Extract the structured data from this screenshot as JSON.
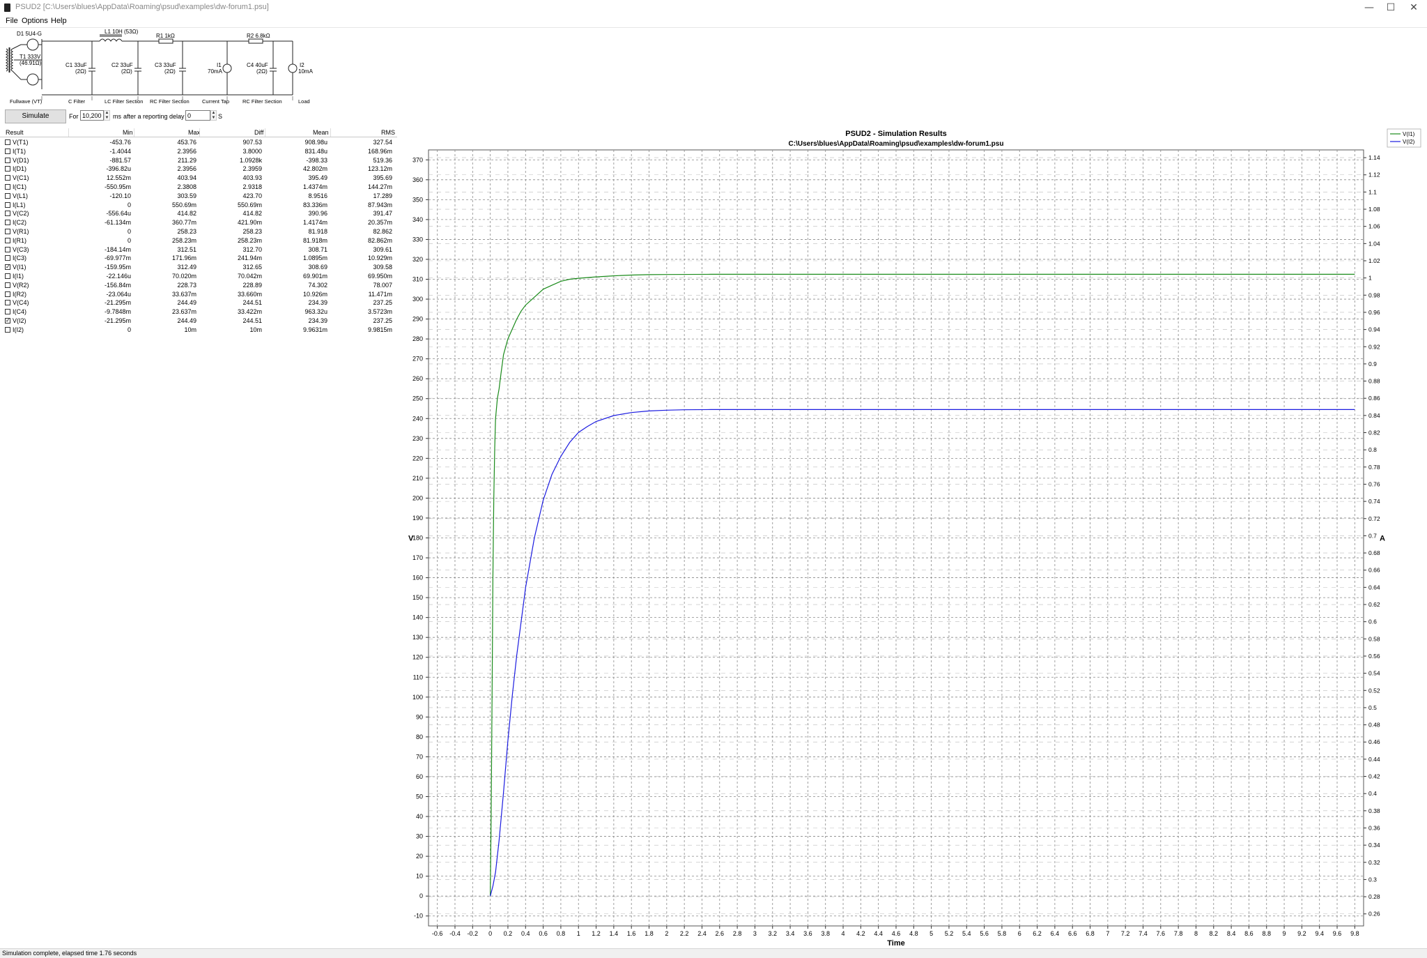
{
  "window": {
    "title": "PSUD2  [C:\\Users\\blues\\AppData\\Roaming\\psud\\examples\\dw-forum1.psu]",
    "minimize": "—",
    "maximize": "☐",
    "close": "✕"
  },
  "menu": {
    "items": [
      "File",
      "Options",
      "Help"
    ]
  },
  "schematic": {
    "labels": {
      "d1": "D1 5U4-G",
      "t1_a": "T1 333V",
      "t1_b": "(46.91Ω)",
      "l1": "L1 10H (53Ω)",
      "r1": "R1 1kΩ",
      "r2": "R2 6.8kΩ",
      "c1_a": "C1 33uF",
      "c1_b": "(2Ω)",
      "c2_a": "C2 33uF",
      "c2_b": "(2Ω)",
      "c3_a": "C3 33uF",
      "c3_b": "(2Ω)",
      "i1_a": "I1",
      "i1_b": "70mA",
      "c4_a": "C4 40uF",
      "c4_b": "(2Ω)",
      "i2_a": "I2",
      "i2_b": "10mA"
    },
    "sections": [
      "Fullwave (VT)",
      "C Filter",
      "LC Filter Section",
      "RC Filter Section",
      "Current Tap",
      "RC Filter Section",
      "Load"
    ]
  },
  "simulation": {
    "button": "Simulate",
    "for_label": "For",
    "duration": "10,200",
    "ms_label": "ms",
    "delay_label": "after a reporting delay of",
    "delay": "0",
    "s_label": "S"
  },
  "results": {
    "columns": [
      "Result",
      "Min",
      "Max",
      "Diff",
      "Mean",
      "RMS"
    ],
    "rows": [
      {
        "name": "V(T1)",
        "checked": false,
        "min": "-453.76",
        "max": "453.76",
        "diff": "907.53",
        "mean": "908.98u",
        "rms": "327.54"
      },
      {
        "name": "I(T1)",
        "checked": false,
        "min": "-1.4044",
        "max": "2.3956",
        "diff": "3.8000",
        "mean": "831.48u",
        "rms": "168.96m"
      },
      {
        "name": "V(D1)",
        "checked": false,
        "min": "-881.57",
        "max": "211.29",
        "diff": "1.0928k",
        "mean": "-398.33",
        "rms": "519.36"
      },
      {
        "name": "I(D1)",
        "checked": false,
        "min": "-396.82u",
        "max": "2.3956",
        "diff": "2.3959",
        "mean": "42.802m",
        "rms": "123.12m"
      },
      {
        "name": "V(C1)",
        "checked": false,
        "min": "12.552m",
        "max": "403.94",
        "diff": "403.93",
        "mean": "395.49",
        "rms": "395.69"
      },
      {
        "name": "I(C1)",
        "checked": false,
        "min": "-550.95m",
        "max": "2.3808",
        "diff": "2.9318",
        "mean": "1.4374m",
        "rms": "144.27m"
      },
      {
        "name": "V(L1)",
        "checked": false,
        "min": "-120.10",
        "max": "303.59",
        "diff": "423.70",
        "mean": "8.9516",
        "rms": "17.289"
      },
      {
        "name": "I(L1)",
        "checked": false,
        "min": "0",
        "max": "550.69m",
        "diff": "550.69m",
        "mean": "83.336m",
        "rms": "87.943m"
      },
      {
        "name": "V(C2)",
        "checked": false,
        "min": "-556.64u",
        "max": "414.82",
        "diff": "414.82",
        "mean": "390.96",
        "rms": "391.47"
      },
      {
        "name": "I(C2)",
        "checked": false,
        "min": "-61.134m",
        "max": "360.77m",
        "diff": "421.90m",
        "mean": "1.4174m",
        "rms": "20.357m"
      },
      {
        "name": "V(R1)",
        "checked": false,
        "min": "0",
        "max": "258.23",
        "diff": "258.23",
        "mean": "81.918",
        "rms": "82.862"
      },
      {
        "name": "I(R1)",
        "checked": false,
        "min": "0",
        "max": "258.23m",
        "diff": "258.23m",
        "mean": "81.918m",
        "rms": "82.862m"
      },
      {
        "name": "V(C3)",
        "checked": false,
        "min": "-184.14m",
        "max": "312.51",
        "diff": "312.70",
        "mean": "308.71",
        "rms": "309.61"
      },
      {
        "name": "I(C3)",
        "checked": false,
        "min": "-69.977m",
        "max": "171.96m",
        "diff": "241.94m",
        "mean": "1.0895m",
        "rms": "10.929m"
      },
      {
        "name": "V(I1)",
        "checked": true,
        "min": "-159.95m",
        "max": "312.49",
        "diff": "312.65",
        "mean": "308.69",
        "rms": "309.58"
      },
      {
        "name": "I(I1)",
        "checked": false,
        "min": "-22.146u",
        "max": "70.020m",
        "diff": "70.042m",
        "mean": "69.901m",
        "rms": "69.950m"
      },
      {
        "name": "V(R2)",
        "checked": false,
        "min": "-156.84m",
        "max": "228.73",
        "diff": "228.89",
        "mean": "74.302",
        "rms": "78.007"
      },
      {
        "name": "I(R2)",
        "checked": false,
        "min": "-23.064u",
        "max": "33.637m",
        "diff": "33.660m",
        "mean": "10.926m",
        "rms": "11.471m"
      },
      {
        "name": "V(C4)",
        "checked": false,
        "min": "-21.295m",
        "max": "244.49",
        "diff": "244.51",
        "mean": "234.39",
        "rms": "237.25"
      },
      {
        "name": "I(C4)",
        "checked": false,
        "min": "-9.7848m",
        "max": "23.637m",
        "diff": "33.422m",
        "mean": "963.32u",
        "rms": "3.5723m"
      },
      {
        "name": "V(I2)",
        "checked": true,
        "min": "-21.295m",
        "max": "244.49",
        "diff": "244.51",
        "mean": "234.39",
        "rms": "237.25"
      },
      {
        "name": "I(I2)",
        "checked": false,
        "min": "0",
        "max": "10m",
        "diff": "10m",
        "mean": "9.9631m",
        "rms": "9.9815m"
      }
    ]
  },
  "status": {
    "text": "Simulation complete, elapsed time 1.76 seconds"
  },
  "chart_data": {
    "type": "line",
    "title": "PSUD2 - Simulation Results",
    "subtitle": "C:\\Users\\blues\\AppData\\Roaming\\psud\\examples\\dw-forum1.psu",
    "xlabel": "Time",
    "ylabel": "V",
    "y2label": "A",
    "xlim": [
      -0.7,
      9.9
    ],
    "ylim": [
      -15,
      375
    ],
    "y2lim": [
      0.246,
      1.149
    ],
    "xticks": [
      -0.6,
      -0.4,
      -0.2,
      0,
      0.2,
      0.4,
      0.6,
      0.8,
      1,
      1.2,
      1.4,
      1.6,
      1.8,
      2,
      2.2,
      2.4,
      2.6,
      2.8,
      3,
      3.2,
      3.4,
      3.6,
      3.8,
      4,
      4.2,
      4.4,
      4.6,
      4.8,
      5,
      5.2,
      5.4,
      5.6,
      5.8,
      6,
      6.2,
      6.4,
      6.6,
      6.8,
      7,
      7.2,
      7.4,
      7.6,
      7.8,
      8,
      8.2,
      8.4,
      8.6,
      8.8,
      9,
      9.2,
      9.4,
      9.6,
      9.8
    ],
    "yticks": [
      -10,
      0,
      10,
      20,
      30,
      40,
      50,
      60,
      70,
      80,
      90,
      100,
      110,
      120,
      130,
      140,
      150,
      160,
      170,
      180,
      190,
      200,
      210,
      220,
      230,
      240,
      250,
      260,
      270,
      280,
      290,
      300,
      310,
      320,
      330,
      340,
      350,
      360,
      370
    ],
    "y2ticks": [
      0.26,
      0.28,
      0.3,
      0.32,
      0.34,
      0.36,
      0.38,
      0.4,
      0.42,
      0.44,
      0.46,
      0.48,
      0.5,
      0.52,
      0.54,
      0.56,
      0.58,
      0.6,
      0.62,
      0.64,
      0.66,
      0.68,
      0.7,
      0.72,
      0.74,
      0.76,
      0.78,
      0.8,
      0.82,
      0.84,
      0.86,
      0.88,
      0.9,
      0.92,
      0.94,
      0.96,
      0.98,
      1,
      1.02,
      1.04,
      1.06,
      1.08,
      1.1,
      1.12,
      1.14
    ],
    "grid": true,
    "legend": "top-right",
    "series": [
      {
        "name": "V(I1)",
        "color": "#1a8a1a",
        "x": [
          0,
          0.01,
          0.02,
          0.03,
          0.04,
          0.05,
          0.06,
          0.08,
          0.1,
          0.12,
          0.15,
          0.2,
          0.25,
          0.3,
          0.35,
          0.4,
          0.5,
          0.6,
          0.7,
          0.8,
          0.9,
          1,
          1.2,
          1.4,
          1.6,
          1.8,
          2,
          2.5,
          3,
          4,
          5,
          6,
          7,
          8,
          9,
          9.8
        ],
        "y": [
          0,
          40,
          100,
          160,
          200,
          225,
          240,
          250,
          255,
          262,
          272,
          280,
          285,
          290,
          294,
          297,
          301,
          305,
          307,
          309,
          310,
          310.5,
          311.2,
          311.7,
          312.1,
          312.3,
          312.4,
          312.5,
          312.5,
          312.5,
          312.5,
          312.5,
          312.5,
          312.5,
          312.5,
          312.5
        ]
      },
      {
        "name": "V(I2)",
        "color": "#1a1ae0",
        "x": [
          0,
          0.03,
          0.06,
          0.1,
          0.15,
          0.2,
          0.25,
          0.3,
          0.4,
          0.5,
          0.6,
          0.7,
          0.8,
          0.9,
          1,
          1.1,
          1.2,
          1.4,
          1.6,
          1.8,
          2,
          2.2,
          2.5,
          3,
          4,
          5,
          6,
          7,
          8,
          9,
          9.8
        ],
        "y": [
          0,
          5,
          12,
          28,
          52,
          78,
          101,
          121,
          155,
          180,
          199,
          212,
          221,
          228,
          233,
          236,
          238.5,
          241.5,
          243,
          243.8,
          244.2,
          244.4,
          244.5,
          244.5,
          244.5,
          244.5,
          244.5,
          244.5,
          244.5,
          244.5,
          244.5
        ]
      }
    ]
  }
}
